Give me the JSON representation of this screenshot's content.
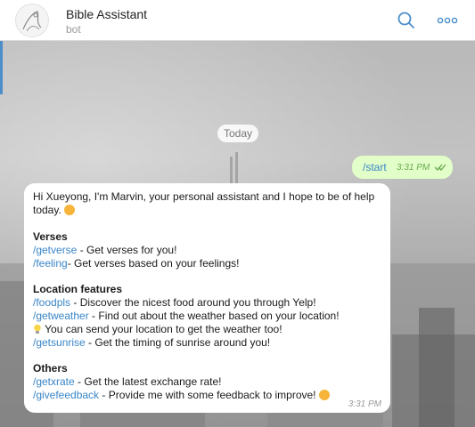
{
  "header": {
    "title": "Bible Assistant",
    "subtitle": "bot"
  },
  "chat": {
    "date_label": "Today",
    "outgoing": {
      "text": "/start",
      "time": "3:31 PM"
    },
    "incoming": {
      "greeting_line1": "Hi Xueyong, I'm Marvin, your personal assistant and I hope to be of help",
      "greeting_line2": "today.",
      "sections": {
        "verses_title": "Verses",
        "getverse_cmd": "/getverse",
        "getverse_desc": " - Get verses for you!",
        "feeling_cmd": "/feeling",
        "feeling_desc": "- Get verses based on your feelings!",
        "location_title": "Location features",
        "foodpls_cmd": "/foodpls",
        "foodpls_desc": " - Discover the nicest food around you through Yelp!",
        "getweather_cmd": "/getweather",
        "getweather_desc": " - Find out about the weather based on your location!",
        "send_location_note": "  You can send your location to get the weather too!",
        "getsunrise_cmd": "/getsunrise",
        "getsunrise_desc": " - Get the timing of sunrise around you!",
        "others_title": "Others",
        "getxrate_cmd": "/getxrate",
        "getxrate_desc": " - Get the latest exchange rate!",
        "givefeedback_cmd": "/givefeedback",
        "givefeedback_desc": " - Provide me with some feedback to improve! "
      },
      "time": "3:31 PM"
    }
  },
  "colors": {
    "accent": "#4b8ec9",
    "command_link": "#3a86c8",
    "outgoing_bubble": "#e2fec9",
    "outgoing_meta": "#6aa84f"
  },
  "icons": {
    "search": "search-icon",
    "more": "more-icon",
    "read_receipt": "double-check-icon",
    "emoji": "smiley-emoji",
    "bulb": "lightbulb-emoji"
  }
}
